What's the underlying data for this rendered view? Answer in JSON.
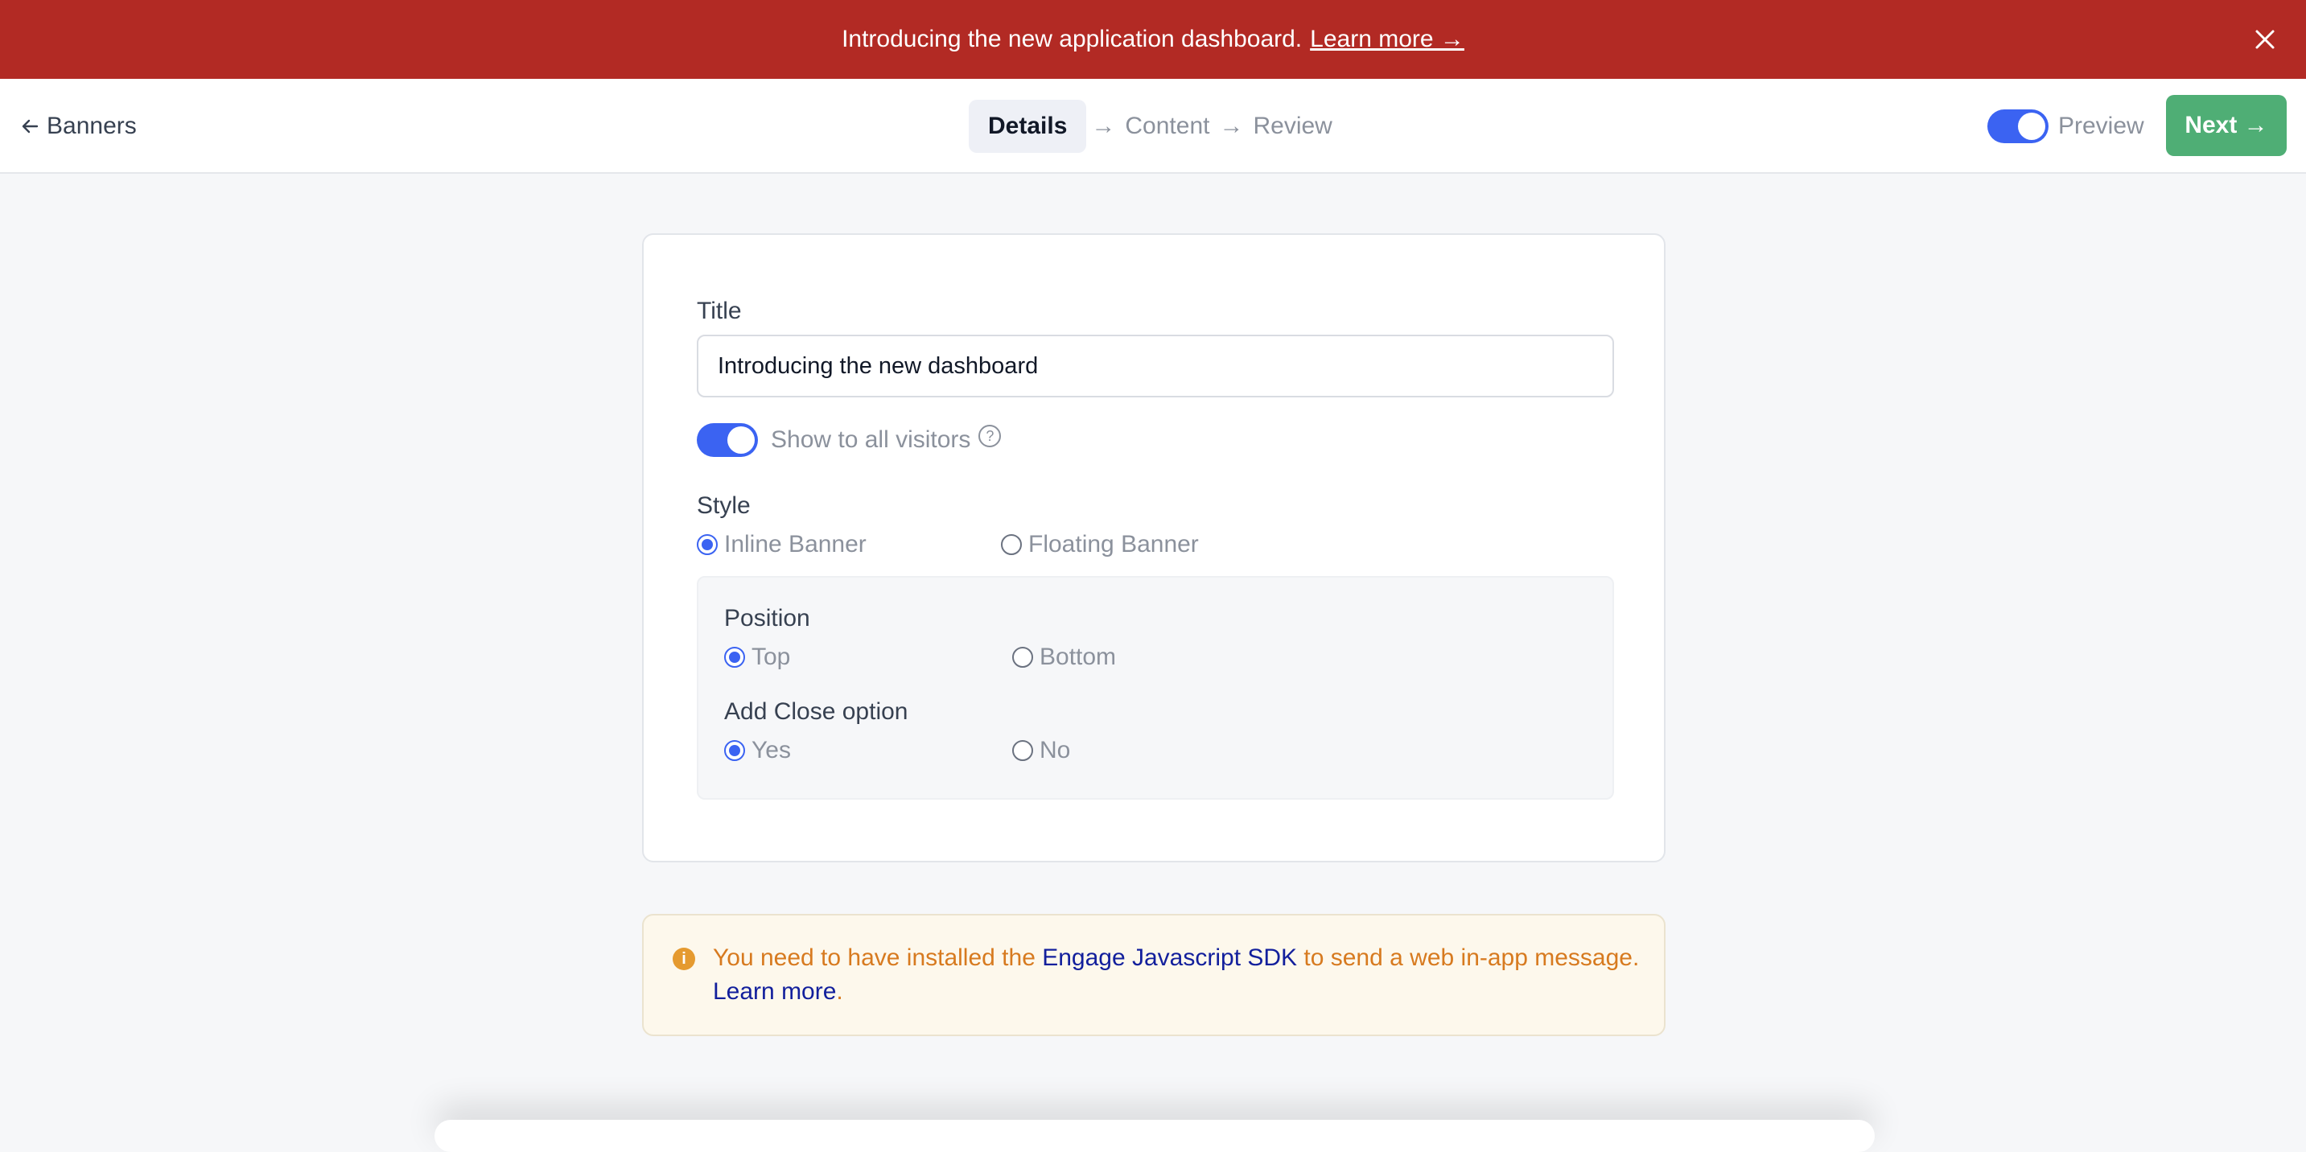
{
  "announcement": {
    "text": "Introducing the new application dashboard.",
    "link": "Learn more →",
    "close_icon": "close-icon"
  },
  "nav": {
    "back_label": "Banners",
    "steps": [
      {
        "label": "Details",
        "active": true
      },
      {
        "label": "Content",
        "active": false
      },
      {
        "label": "Review",
        "active": false
      }
    ],
    "arrow": "→",
    "preview_label": "Preview",
    "preview_on": true,
    "next_label": "Next →",
    "accent": "#3b63f2",
    "next_color": "#4fae75"
  },
  "form": {
    "title_label": "Title",
    "title_value": "Introducing the new dashboard",
    "visitors_label": "Show to all visitors",
    "visitors_on": true,
    "style_label": "Style",
    "style_options": [
      "Inline Banner",
      "Floating Banner"
    ],
    "style_selected": "Inline Banner",
    "position_label": "Position",
    "position_options": [
      "Top",
      "Bottom"
    ],
    "position_selected": "Top",
    "close_label": "Add Close option",
    "close_options": [
      "Yes",
      "No"
    ],
    "close_selected": "Yes"
  },
  "info": {
    "text_before": "You need to have installed the ",
    "sdk_link": "Engage Javascript SDK",
    "text_after": " to send a web in-app message.",
    "learn_more": "Learn more",
    "period": "."
  }
}
